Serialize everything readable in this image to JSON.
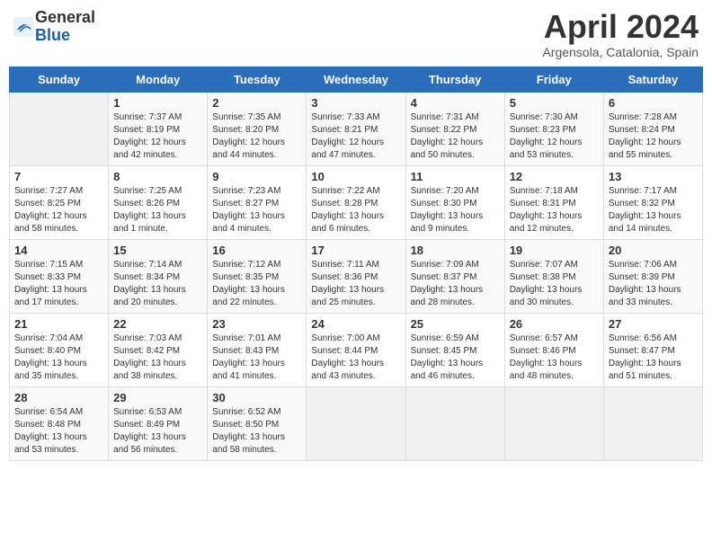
{
  "header": {
    "logo_line1": "General",
    "logo_line2": "Blue",
    "title": "April 2024",
    "location": "Argensola, Catalonia, Spain"
  },
  "days_of_week": [
    "Sunday",
    "Monday",
    "Tuesday",
    "Wednesday",
    "Thursday",
    "Friday",
    "Saturday"
  ],
  "weeks": [
    [
      {
        "day": "",
        "info": ""
      },
      {
        "day": "1",
        "info": "Sunrise: 7:37 AM\nSunset: 8:19 PM\nDaylight: 12 hours\nand 42 minutes."
      },
      {
        "day": "2",
        "info": "Sunrise: 7:35 AM\nSunset: 8:20 PM\nDaylight: 12 hours\nand 44 minutes."
      },
      {
        "day": "3",
        "info": "Sunrise: 7:33 AM\nSunset: 8:21 PM\nDaylight: 12 hours\nand 47 minutes."
      },
      {
        "day": "4",
        "info": "Sunrise: 7:31 AM\nSunset: 8:22 PM\nDaylight: 12 hours\nand 50 minutes."
      },
      {
        "day": "5",
        "info": "Sunrise: 7:30 AM\nSunset: 8:23 PM\nDaylight: 12 hours\nand 53 minutes."
      },
      {
        "day": "6",
        "info": "Sunrise: 7:28 AM\nSunset: 8:24 PM\nDaylight: 12 hours\nand 55 minutes."
      }
    ],
    [
      {
        "day": "7",
        "info": "Sunrise: 7:27 AM\nSunset: 8:25 PM\nDaylight: 12 hours\nand 58 minutes."
      },
      {
        "day": "8",
        "info": "Sunrise: 7:25 AM\nSunset: 8:26 PM\nDaylight: 13 hours\nand 1 minute."
      },
      {
        "day": "9",
        "info": "Sunrise: 7:23 AM\nSunset: 8:27 PM\nDaylight: 13 hours\nand 4 minutes."
      },
      {
        "day": "10",
        "info": "Sunrise: 7:22 AM\nSunset: 8:28 PM\nDaylight: 13 hours\nand 6 minutes."
      },
      {
        "day": "11",
        "info": "Sunrise: 7:20 AM\nSunset: 8:30 PM\nDaylight: 13 hours\nand 9 minutes."
      },
      {
        "day": "12",
        "info": "Sunrise: 7:18 AM\nSunset: 8:31 PM\nDaylight: 13 hours\nand 12 minutes."
      },
      {
        "day": "13",
        "info": "Sunrise: 7:17 AM\nSunset: 8:32 PM\nDaylight: 13 hours\nand 14 minutes."
      }
    ],
    [
      {
        "day": "14",
        "info": "Sunrise: 7:15 AM\nSunset: 8:33 PM\nDaylight: 13 hours\nand 17 minutes."
      },
      {
        "day": "15",
        "info": "Sunrise: 7:14 AM\nSunset: 8:34 PM\nDaylight: 13 hours\nand 20 minutes."
      },
      {
        "day": "16",
        "info": "Sunrise: 7:12 AM\nSunset: 8:35 PM\nDaylight: 13 hours\nand 22 minutes."
      },
      {
        "day": "17",
        "info": "Sunrise: 7:11 AM\nSunset: 8:36 PM\nDaylight: 13 hours\nand 25 minutes."
      },
      {
        "day": "18",
        "info": "Sunrise: 7:09 AM\nSunset: 8:37 PM\nDaylight: 13 hours\nand 28 minutes."
      },
      {
        "day": "19",
        "info": "Sunrise: 7:07 AM\nSunset: 8:38 PM\nDaylight: 13 hours\nand 30 minutes."
      },
      {
        "day": "20",
        "info": "Sunrise: 7:06 AM\nSunset: 8:39 PM\nDaylight: 13 hours\nand 33 minutes."
      }
    ],
    [
      {
        "day": "21",
        "info": "Sunrise: 7:04 AM\nSunset: 8:40 PM\nDaylight: 13 hours\nand 35 minutes."
      },
      {
        "day": "22",
        "info": "Sunrise: 7:03 AM\nSunset: 8:42 PM\nDaylight: 13 hours\nand 38 minutes."
      },
      {
        "day": "23",
        "info": "Sunrise: 7:01 AM\nSunset: 8:43 PM\nDaylight: 13 hours\nand 41 minutes."
      },
      {
        "day": "24",
        "info": "Sunrise: 7:00 AM\nSunset: 8:44 PM\nDaylight: 13 hours\nand 43 minutes."
      },
      {
        "day": "25",
        "info": "Sunrise: 6:59 AM\nSunset: 8:45 PM\nDaylight: 13 hours\nand 46 minutes."
      },
      {
        "day": "26",
        "info": "Sunrise: 6:57 AM\nSunset: 8:46 PM\nDaylight: 13 hours\nand 48 minutes."
      },
      {
        "day": "27",
        "info": "Sunrise: 6:56 AM\nSunset: 8:47 PM\nDaylight: 13 hours\nand 51 minutes."
      }
    ],
    [
      {
        "day": "28",
        "info": "Sunrise: 6:54 AM\nSunset: 8:48 PM\nDaylight: 13 hours\nand 53 minutes."
      },
      {
        "day": "29",
        "info": "Sunrise: 6:53 AM\nSunset: 8:49 PM\nDaylight: 13 hours\nand 56 minutes."
      },
      {
        "day": "30",
        "info": "Sunrise: 6:52 AM\nSunset: 8:50 PM\nDaylight: 13 hours\nand 58 minutes."
      },
      {
        "day": "",
        "info": ""
      },
      {
        "day": "",
        "info": ""
      },
      {
        "day": "",
        "info": ""
      },
      {
        "day": "",
        "info": ""
      }
    ]
  ]
}
